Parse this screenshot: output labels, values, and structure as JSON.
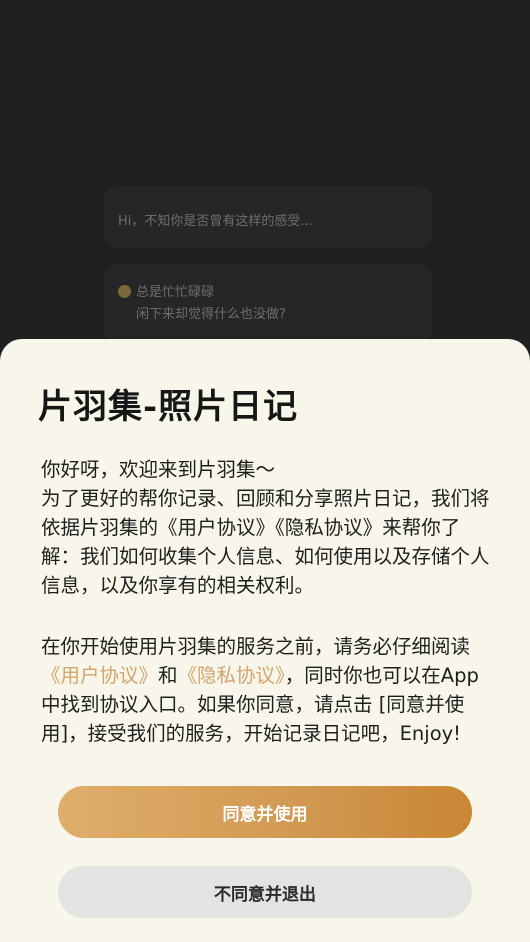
{
  "background": {
    "message_1": "Hi，不知你是否曾有这样的感受...",
    "message_2_line_1": "总是忙忙碌碌",
    "message_2_line_2": "闲下来却觉得什么也没做?"
  },
  "dialog": {
    "title": "片羽集-照片日记",
    "intro_lines": [
      "你好呀，欢迎来到片羽集～",
      "为了更好的帮你记录、回顾和分享照片日记，我们将依据片羽集的《用户协议》《隐私协议》来帮你了解：我们如何收集个人信息、如何使用以及存储个人信息，以及你享有的相关权利。"
    ],
    "notice_before": "在你开始使用片羽集的服务之前，请务必仔细阅读",
    "user_agreement_link": "《用户协议》",
    "notice_and": "和",
    "privacy_agreement_link": "《隐私协议》",
    "notice_after": "，同时你也可以在App 中找到协议入口。如果你同意，请点击 [同意并使用]，接受我们的服务，开始记录日记吧，Enjoy!",
    "agree_button": "同意并使用",
    "decline_button": "不同意并退出"
  },
  "colors": {
    "background": "#202020",
    "sheet": "#f8f5ea",
    "link": "#d2a56c",
    "agree_gradient_start": "#dfae6a",
    "agree_gradient_end": "#c98635",
    "decline_button": "#e3e3e1"
  }
}
